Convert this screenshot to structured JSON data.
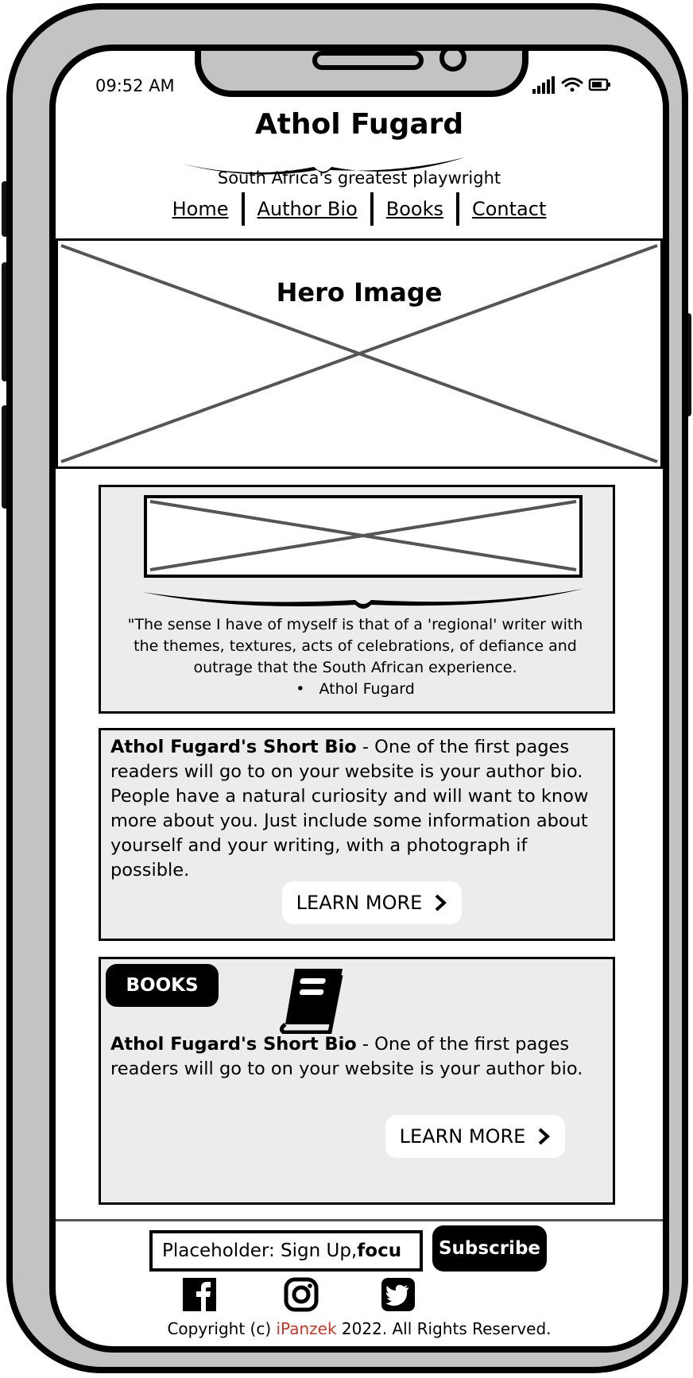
{
  "status_bar": {
    "time": "09:52 AM"
  },
  "header": {
    "title": "Athol Fugard",
    "tagline": "South Africa's greatest playwright",
    "nav": [
      "Home",
      "Author Bio",
      "Books",
      "Contact"
    ]
  },
  "hero": {
    "caption": "Hero Image"
  },
  "quote_card": {
    "quote": "\"The sense I have of myself is that of a 'regional' writer with the themes, textures, acts of celebrations, of defiance and outrage that the South African experience.",
    "author": "Athol Fugard"
  },
  "bio_card": {
    "heading": "Athol Fugard's Short Bio",
    "text": " - One of the first pages readers will go to on your website is your author bio. People have a natural curiosity and will want to know more about you. Just include some information about yourself and your writing, with a photograph if possible.",
    "button": "LEARN MORE"
  },
  "books_card": {
    "badge": "BOOKS",
    "heading": "Athol Fugard's Short Bio",
    "text": " - One of the first pages readers will go to on your website is your author bio.",
    "button": "LEARN MORE"
  },
  "footer": {
    "input_value": "Placeholder: Sign Up, ",
    "input_value_bold": "focu",
    "subscribe": "Subscribe",
    "copyright_prefix": "Copyright (c) ",
    "copyright_brand": "iPanzek",
    "copyright_suffix": " 2022. All Rights Reserved.",
    "brand_color": "#c0392b"
  },
  "icons": [
    "signal-icon",
    "wifi-icon",
    "battery-icon",
    "book-icon",
    "facebook-icon",
    "instagram-icon",
    "twitter-icon",
    "chevron-right-icon"
  ]
}
